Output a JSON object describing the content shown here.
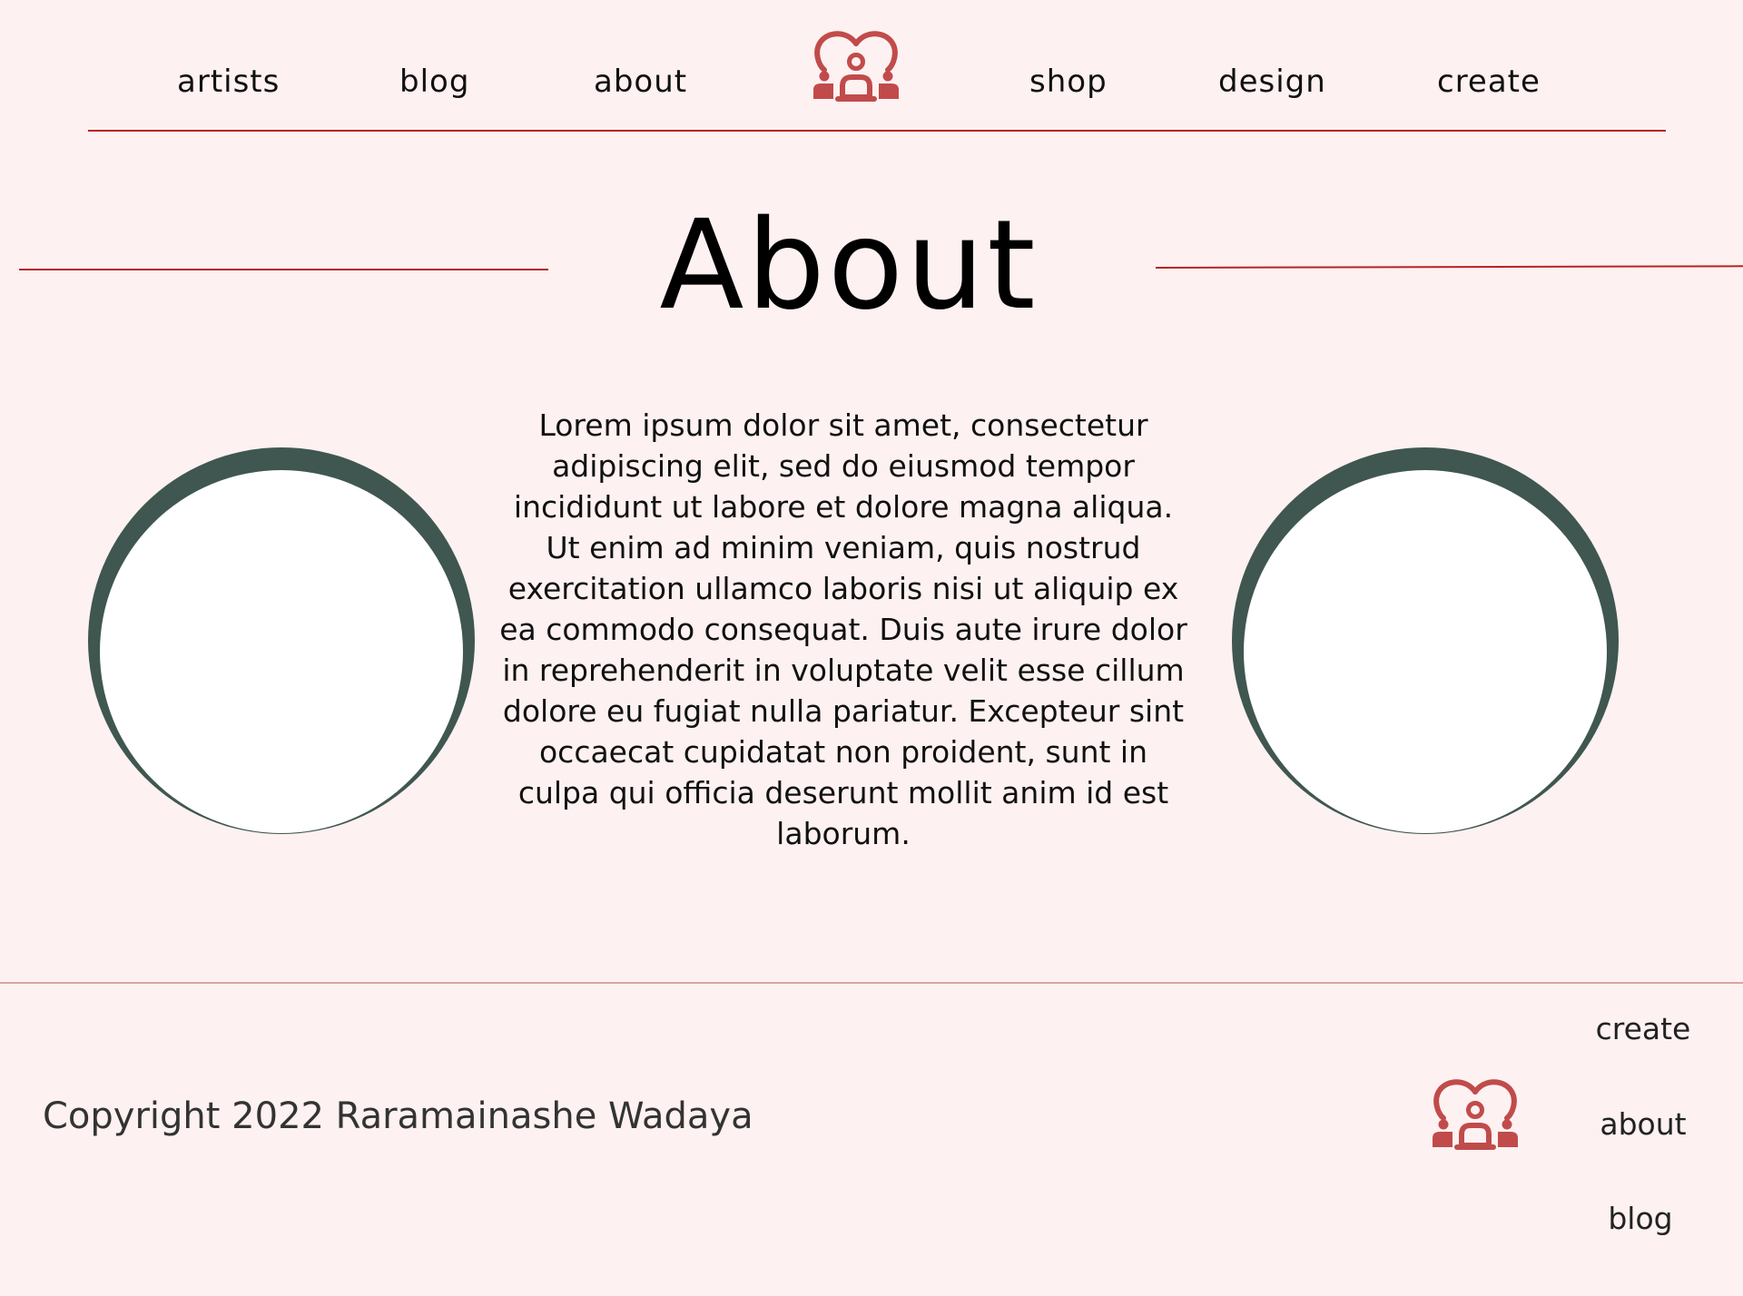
{
  "nav": {
    "items": [
      {
        "label": "artists"
      },
      {
        "label": "blog"
      },
      {
        "label": "about"
      },
      {
        "label": "shop"
      },
      {
        "label": "design"
      },
      {
        "label": "create"
      }
    ],
    "logo_icon": "heart-group-people-icon"
  },
  "main": {
    "title": "About",
    "text": "Lorem ipsum dolor sit amet, consectetur adipiscing elit, sed do eiusmod tempor incididunt ut labore et dolore magna aliqua. Ut enim ad minim veniam, quis nostrud exercitation ullamco laboris nisi ut aliquip ex ea commodo consequat. Duis aute irure dolor in reprehenderit in voluptate velit esse cillum dolore eu fugiat nulla pariatur. Excepteur sint occaecat cupidatat non proident, sunt in culpa qui officia deserunt mollit anim id est laborum."
  },
  "footer": {
    "copyright": "Copyright 2022 Raramainashe Wadaya",
    "links": [
      {
        "label": "create"
      },
      {
        "label": "about"
      },
      {
        "label": "blog"
      }
    ],
    "logo_icon": "heart-group-people-icon"
  },
  "colors": {
    "background": "#fdf1f1",
    "accent": "#b72323",
    "logo": "#c14b4b",
    "circle_ring": "#3f5750",
    "footer_rule": "#d8a5a5"
  }
}
